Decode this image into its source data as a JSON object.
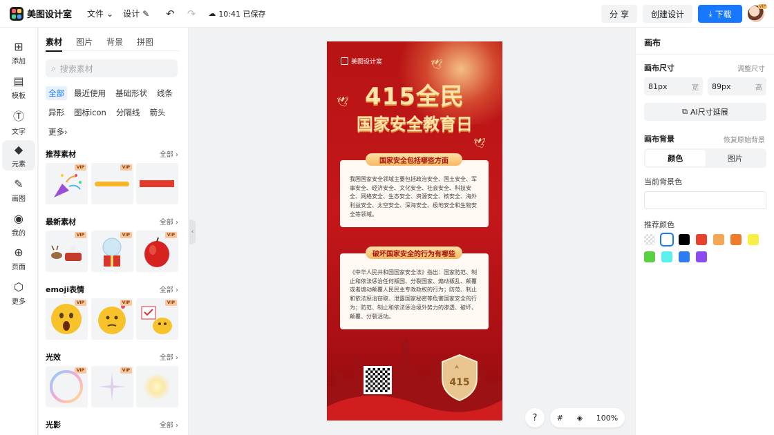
{
  "topbar": {
    "app_name": "美图设计室",
    "menu_file": "文件",
    "menu_design": "设计",
    "save_time": "10:41 已保存",
    "share_label": "分 享",
    "create_label": "创建设计",
    "download_label": "下载",
    "avatar_badge": "VIP"
  },
  "rail": {
    "items": [
      {
        "label": "添加",
        "icon": "plus-square-icon"
      },
      {
        "label": "模板",
        "icon": "layout-icon"
      },
      {
        "label": "文字",
        "icon": "text-icon"
      },
      {
        "label": "元素",
        "icon": "shapes-icon"
      },
      {
        "label": "画图",
        "icon": "pencil-icon"
      },
      {
        "label": "我的",
        "icon": "user-icon"
      },
      {
        "label": "页面",
        "icon": "page-add-icon"
      },
      {
        "label": "更多",
        "icon": "cube-icon"
      }
    ],
    "active_index": 3
  },
  "panel": {
    "tabs": [
      "素材",
      "图片",
      "背景",
      "拼图"
    ],
    "active_tab": 0,
    "search_placeholder": "搜索素材",
    "chips": [
      "全部",
      "最近使用",
      "基础形状",
      "线条",
      "异形",
      "图标icon",
      "分隔线",
      "箭头",
      "更多"
    ],
    "all_label": "全部",
    "vip_label": "VIP",
    "sections": [
      {
        "title": "推荐素材",
        "items": [
          "party-popper",
          "yellow-brush-stroke",
          "red-bar"
        ]
      },
      {
        "title": "最新素材",
        "items": [
          "reindeer-sleigh",
          "snow-globe-gift",
          "red-apple"
        ]
      },
      {
        "title": "emoji表情",
        "items": [
          "shocked-emoji",
          "thinking-emoji",
          "check-duck-emoji"
        ]
      },
      {
        "title": "光效",
        "items": [
          "rainbow-bubble",
          "sparkle-star",
          "glow-light"
        ]
      },
      {
        "title": "光影",
        "items": []
      }
    ]
  },
  "poster": {
    "brand": "美图设计室",
    "title_line1": "415全民",
    "title_line2": "国家安全教育日",
    "card1_title": "国家安全包括哪些方面",
    "card1_text": "我国国家安全领域主要包括政治安全、国土安全、军事安全、经济安全、文化安全、社会安全、科技安全、网络安全、生态安全、资源安全、核安全、海外利益安全、太空安全、深海安全、极地安全和生物安全等领域。",
    "card2_title": "破坏国家安全的行为有哪些",
    "card2_text": "《中华人民共和国国家安全法》指出：国家防范、制止和依法惩治任何叛国、分裂国家、煽动叛乱、颠覆或者煽动颠覆人民民主专政政权的行为；防范、制止和依法惩治窃取、泄露国家秘密等危害国家安全的行为；防范、制止和依法惩治境外势力的渗透、破坏、颠覆、分裂活动。",
    "badge_text": "415"
  },
  "canvas_tools": {
    "help": "?",
    "zoom": "100%"
  },
  "props": {
    "title": "画布",
    "size_label": "画布尺寸",
    "resize_label": "调整尺寸",
    "width_value": "81px",
    "width_unit": "宽",
    "height_value": "89px",
    "height_unit": "高",
    "ai_extend_label": "AI尺寸延展",
    "bg_label": "画布背景",
    "restore_label": "恢复原始背景",
    "seg_color": "颜色",
    "seg_image": "图片",
    "current_bg_label": "当前背景色",
    "recommend_label": "推荐颜色",
    "swatches": [
      "transparent",
      "#ffffff",
      "#000000",
      "#e8412b",
      "#f5a654",
      "#f07c2a",
      "#f7ef45",
      "#5ccf45",
      "#59f0ee",
      "#2d7cf0",
      "#8a4cf0"
    ]
  }
}
